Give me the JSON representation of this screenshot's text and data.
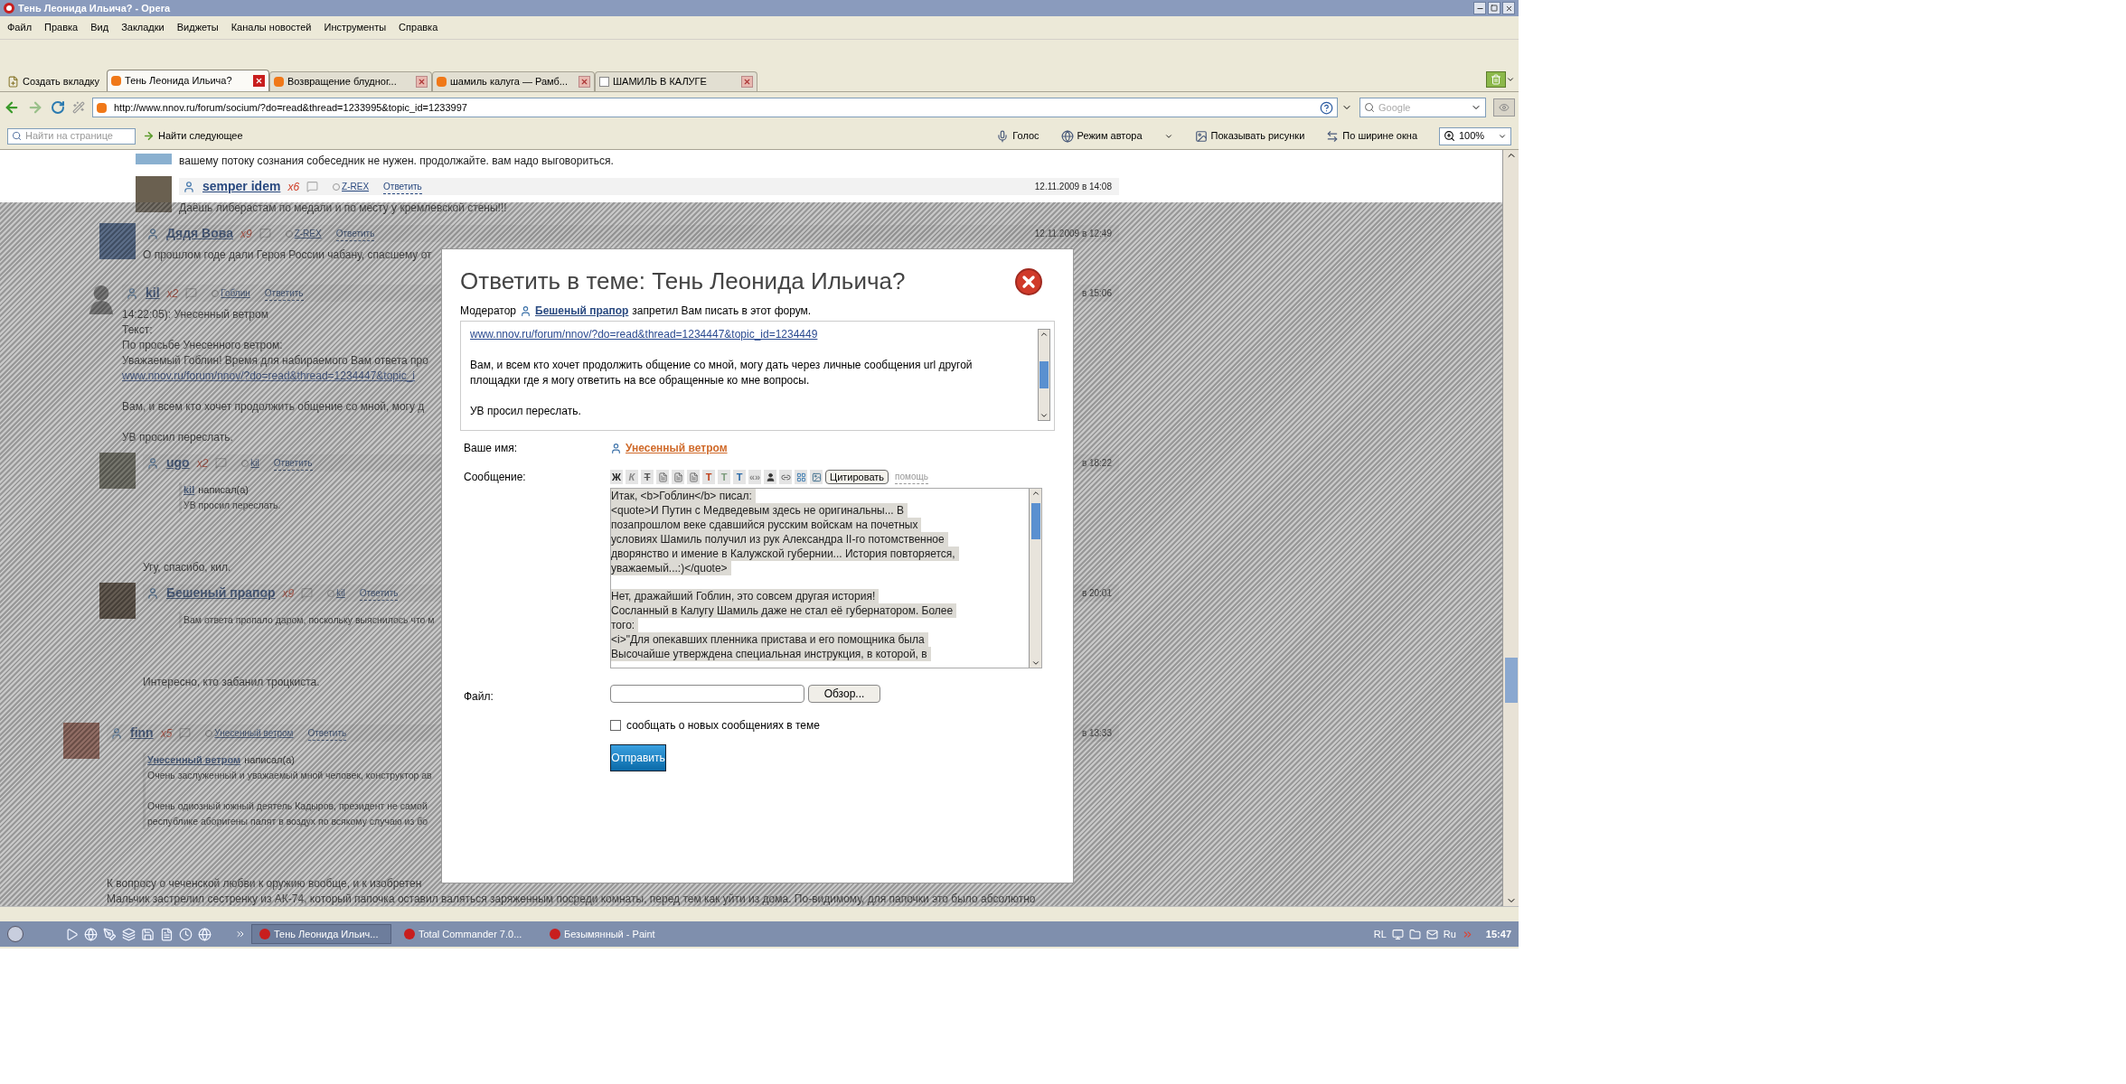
{
  "window": {
    "title": "Тень Леонида Ильича? - Opera"
  },
  "menu": [
    "Файл",
    "Правка",
    "Вид",
    "Закладки",
    "Виджеты",
    "Каналы новостей",
    "Инструменты",
    "Справка"
  ],
  "new_tab": "Создать вкладку",
  "tabs": [
    {
      "label": "Тень Леонида Ильича?",
      "selected": true
    },
    {
      "label": "Возвращение блудног...",
      "selected": false
    },
    {
      "label": "шамиль калуга — Рамб...",
      "selected": false
    },
    {
      "label": "ШАМИЛЬ В КАЛУГЕ",
      "selected": false
    }
  ],
  "address": {
    "url": "http://www.nnov.ru/forum/socium/?do=read&thread=1233995&topic_id=1233997"
  },
  "search": {
    "placeholder": "Google"
  },
  "find_bar": {
    "placeholder": "Найти на странице",
    "find_next": "Найти следующее"
  },
  "tools": [
    "Голос",
    "Режим автора",
    "Показывать рисунки",
    "По ширине окна"
  ],
  "zoom": "100%",
  "thread": [
    {
      "kind": "group",
      "children": [
        {
          "kind": "group",
          "children": [
            {
              "kind": "tail",
              "lines": [
                "вашему потоку сознания собеседник не нужен. продолжайте. вам надо выговориться."
              ]
            },
            {
              "kind": "post",
              "avatar": {
                "kind": "photo"
              },
              "author": "semper idem",
              "rating": "x6",
              "reply_to": "Z-REX",
              "reply": "Ответить",
              "date": "12.11.2009 в 14:08",
              "body": [
                {
                  "kind": "text",
                  "lines": [
                    "Даёшь либерастам по медали и по месту у кремлевской стены!!!"
                  ]
                }
              ]
            }
          ]
        },
        {
          "kind": "post",
          "avatar": {
            "kind": "photo"
          },
          "author": "Дядя Вова",
          "rating": "x9",
          "reply_to": "Z-REX",
          "reply": "Ответить",
          "date": "12.11.2009 в 12:49",
          "body": [
            {
              "kind": "text",
              "lines": [
                "О прошлом годе дали Героя России чабану, спасшему от"
              ]
            }
          ]
        },
        {
          "kind": "post",
          "avatar": {
            "kind": "silhouette"
          },
          "author": "kil",
          "rating": "x2",
          "reply_to": "Гоблин",
          "reply": "Ответить",
          "date": "в 15:06",
          "body": [
            {
              "kind": "text",
              "lines": [
                "14:22:05): Унесенный ветром",
                "Текст:",
                "По просьбе Унесенного ветром:",
                "Уважаемый Гоблин! Время для набираемого Вам ответа про"
              ]
            },
            {
              "kind": "link",
              "text": "www.nnov.ru/forum/nnov/?do=read&thread=1234447&topic_i"
            },
            {
              "kind": "text",
              "lines": [
                "Вам, и всем кто хочет продолжить общение со мной, могу д"
              ]
            },
            {
              "kind": "text",
              "lines": [
                "УВ просил переслать."
              ]
            }
          ]
        },
        {
          "kind": "post",
          "avatar": {
            "kind": "photo"
          },
          "author": "ugo",
          "rating": "x2",
          "reply_to": "kil",
          "reply": "Ответить",
          "date": "в 18:22",
          "body": [
            {
              "kind": "quote",
              "author": "kil",
              "wrote": "написал(а)",
              "paragraphs": [
                [
                  "УВ просил переслать."
                ]
              ]
            },
            {
              "kind": "text",
              "lines": [
                "Угу, спасибо, кил."
              ]
            }
          ]
        },
        {
          "kind": "post",
          "avatar": {
            "kind": "photo"
          },
          "author": "Бешеный прапор",
          "rating": "x9",
          "reply_to": "kil",
          "reply": "Ответить",
          "date": "в 20:01",
          "body": [
            {
              "kind": "quote",
              "paragraphs": [
                [
                  "Вам ответа пропало даром, поскольку выяснилось что м"
                ]
              ]
            },
            {
              "kind": "text",
              "lines": [
                "Интересно, кто забанил троцкиста."
              ]
            }
          ]
        }
      ]
    },
    {
      "kind": "post",
      "avatar": {
        "kind": "photo"
      },
      "author": "finn",
      "rating": "x5",
      "reply_to": "Унесенный ветром",
      "reply": "Ответить",
      "date": "в 13:33",
      "body": [
        {
          "kind": "quote",
          "author": "Унесенный ветром",
          "wrote": "написал(а)",
          "paragraphs": [
            [
              "Очень заслуженный и уважаемый мной человек, конструктор ав"
            ],
            [
              "Очень одиозный южный деятель Кадыров, президент не самой",
              "республике аборигены палят в воздух по всякому случаю из бо"
            ]
          ]
        },
        {
          "kind": "text",
          "lines": [
            "К вопросу о чеченской любви к оружию вообще, и к изобретен",
            "Мальчик застрелил сестренку из АК-74, который папочка оставил валяться заряженным посреди комнаты, перед тем как уйти из дома. По-видимому, для папочки это было абсолютно"
          ]
        }
      ]
    }
  ],
  "modal": {
    "title": "Ответить в теме: Тень Леонида Ильича?",
    "notice": {
      "before": "Модератор",
      "moderator": "Бешеный прапор",
      "after": "запретил Вам писать в этот форум."
    },
    "quoted": {
      "link": "www.nnov.ru/forum/nnov/?do=read&thread=1234447&topic_id=1234449",
      "paragraphs": [
        "Вам, и всем кто хочет продолжить общение со мной, могу дать через личные сообщения url другой площадки где я могу ответить на все обращенные ко мне вопросы.",
        "УВ просил переслать."
      ]
    },
    "name_label": "Ваше имя:",
    "name": "Унесенный ветром",
    "message_label": "Сообщение:",
    "tools": [
      {
        "kind": "bold",
        "label": "Ж"
      },
      {
        "kind": "italic",
        "label": "К"
      },
      {
        "kind": "strike",
        "label": "Т"
      },
      {
        "kind": "doc"
      },
      {
        "kind": "doc"
      },
      {
        "kind": "doc"
      },
      {
        "kind": "color",
        "label": "Т",
        "color": "#c0401a"
      },
      {
        "kind": "color",
        "label": "Т",
        "color": "#7a9a7a"
      },
      {
        "kind": "color",
        "label": "Т",
        "color": "#2a6aa8"
      },
      {
        "kind": "code",
        "label": "«»"
      },
      {
        "kind": "person"
      },
      {
        "kind": "link"
      },
      {
        "kind": "grid"
      },
      {
        "kind": "image"
      }
    ],
    "quote_button": "Цитировать",
    "help": "помощь",
    "message": [
      [
        "Итак, <b>Гоблин</b> писал:",
        "<quote>И Путин с Медведевым здесь не оригинальны... В",
        "позапрошлом веке сдавшийся русским войскам на почетных",
        "условиях Шамиль получил из рук Александра II-го потомственное",
        "дворянство и имение в Калужской губернии... История повторяется,",
        "уважаемый...:)</quote>"
      ],
      [
        "Нет, дражайший Гоблин, это совсем другая история!",
        "Сосланный в Калугу Шамиль даже не стал её губернатором. Более",
        "того:",
        "<i>\"Для опекавших пленника пристава и его помощника была",
        "Высочайше утверждена специальная инструкция, в которой, в"
      ]
    ],
    "file_label": "Файл:",
    "browse": "Обзор...",
    "subscribe": {
      "label": "сообщать о новых сообщениях в теме",
      "checked": false
    },
    "submit": "Отправить"
  },
  "taskbar": {
    "tasks": [
      {
        "label": "Тень Леонида Ильич...",
        "selected": true
      },
      {
        "label": "Total Commander 7.0...",
        "selected": false
      },
      {
        "label": "Безымянный - Paint",
        "selected": false
      }
    ],
    "tray": [
      "RL",
      "Ru"
    ],
    "clock": "15:47"
  }
}
